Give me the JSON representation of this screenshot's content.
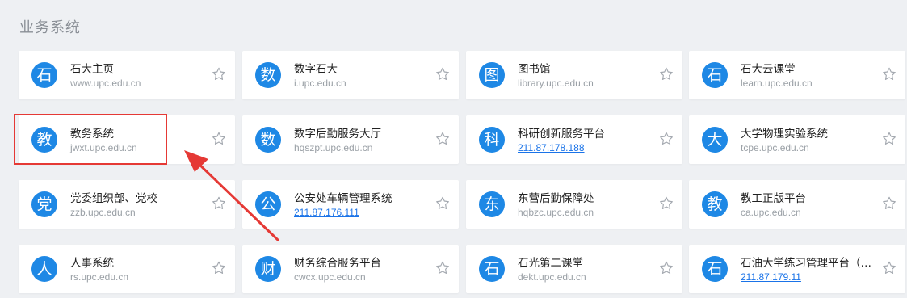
{
  "section": {
    "title": "业务系统"
  },
  "colors": {
    "icon_bg": "#1e88e5",
    "highlight": "#e53935",
    "link": "#1a73e8"
  },
  "cards": [
    {
      "icon": "石",
      "name": "石大主页",
      "url": "www.upc.edu.cn",
      "url_is_link": false
    },
    {
      "icon": "数",
      "name": "数字石大",
      "url": "i.upc.edu.cn",
      "url_is_link": false
    },
    {
      "icon": "图",
      "name": "图书馆",
      "url": "library.upc.edu.cn",
      "url_is_link": false
    },
    {
      "icon": "石",
      "name": "石大云课堂",
      "url": "learn.upc.edu.cn",
      "url_is_link": false
    },
    {
      "icon": "教",
      "name": "教务系统",
      "url": "jwxt.upc.edu.cn",
      "url_is_link": false
    },
    {
      "icon": "数",
      "name": "数字后勤服务大厅",
      "url": "hqszpt.upc.edu.cn",
      "url_is_link": false
    },
    {
      "icon": "科",
      "name": "科研创新服务平台",
      "url": "211.87.178.188",
      "url_is_link": true
    },
    {
      "icon": "大",
      "name": "大学物理实验系统",
      "url": "tcpe.upc.edu.cn",
      "url_is_link": false
    },
    {
      "icon": "党",
      "name": "党委组织部、党校",
      "url": "zzb.upc.edu.cn",
      "url_is_link": false
    },
    {
      "icon": "公",
      "name": "公安处车辆管理系统",
      "url": "211.87.176.111",
      "url_is_link": true
    },
    {
      "icon": "东",
      "name": "东营后勤保障处",
      "url": "hqbzc.upc.edu.cn",
      "url_is_link": false
    },
    {
      "icon": "教",
      "name": "教工正版平台",
      "url": "ca.upc.edu.cn",
      "url_is_link": false
    },
    {
      "icon": "人",
      "name": "人事系统",
      "url": "rs.upc.edu.cn",
      "url_is_link": false
    },
    {
      "icon": "财",
      "name": "财务综合服务平台",
      "url": "cwcx.upc.edu.cn",
      "url_is_link": false
    },
    {
      "icon": "石",
      "name": "石光第二课堂",
      "url": "dekt.upc.edu.cn",
      "url_is_link": false
    },
    {
      "icon": "石",
      "name": "石油大学练习管理平台（…",
      "url": "211.87.179.11",
      "url_is_link": true
    }
  ]
}
